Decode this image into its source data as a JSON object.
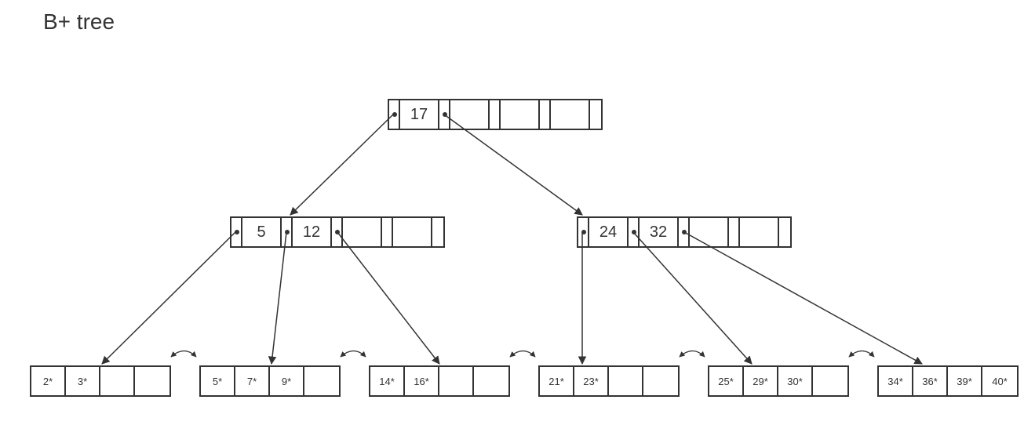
{
  "title": "B+ tree",
  "root": {
    "keys": [
      "17",
      "",
      "",
      ""
    ]
  },
  "internal_left": {
    "keys": [
      "5",
      "12",
      "",
      ""
    ]
  },
  "internal_right": {
    "keys": [
      "24",
      "32",
      "",
      ""
    ]
  },
  "leaves": [
    {
      "cells": [
        "2*",
        "3*",
        "",
        ""
      ]
    },
    {
      "cells": [
        "5*",
        "7*",
        "9*",
        ""
      ]
    },
    {
      "cells": [
        "14*",
        "16*",
        "",
        ""
      ]
    },
    {
      "cells": [
        "21*",
        "23*",
        "",
        ""
      ]
    },
    {
      "cells": [
        "25*",
        "29*",
        "30*",
        ""
      ]
    },
    {
      "cells": [
        "34*",
        "36*",
        "39*",
        "40*"
      ]
    }
  ]
}
